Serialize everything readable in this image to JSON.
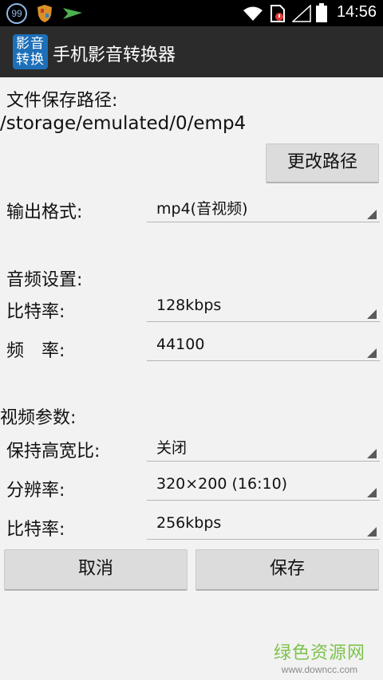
{
  "status_bar": {
    "time": "14:56",
    "badge": "99",
    "icons": [
      "notification-99-icon",
      "security-shield-icon",
      "airplane-icon",
      "wifi-icon",
      "sim-error-icon",
      "signal-icon",
      "battery-icon"
    ]
  },
  "app": {
    "logo_line1": "影音",
    "logo_line2": "转换",
    "title": "手机影音转换器"
  },
  "file": {
    "path_label": "文件保存路径:",
    "path_value": "/storage/emulated/0/emp4",
    "change_path_button": "更改路径"
  },
  "output": {
    "label": "输出格式:",
    "value": "mp4(音视频)"
  },
  "audio": {
    "section_label": "音频设置:",
    "bitrate_label": "比特率:",
    "bitrate_value": "128kbps",
    "samplerate_label": "频　率:",
    "samplerate_value": "44100"
  },
  "video": {
    "section_label": "视频参数:",
    "aspect_label": "保持高宽比:",
    "aspect_value": "关闭",
    "resolution_label": "分辨率:",
    "resolution_value": "320×200 (16:10)",
    "bitrate_label": "比特率:",
    "bitrate_value": "256kbps"
  },
  "actions": {
    "cancel": "取消",
    "save": "保存"
  },
  "watermark": {
    "line1": "绿色资源网",
    "line2": "www.downcc.com"
  },
  "colors": {
    "status_bar": "#000000",
    "action_bar": "#2b2b2b",
    "logo_bg": "#1d6fb8",
    "background": "#f2f2f2",
    "button_bg": "#dcdcdc",
    "watermark": "#7dc24b"
  }
}
